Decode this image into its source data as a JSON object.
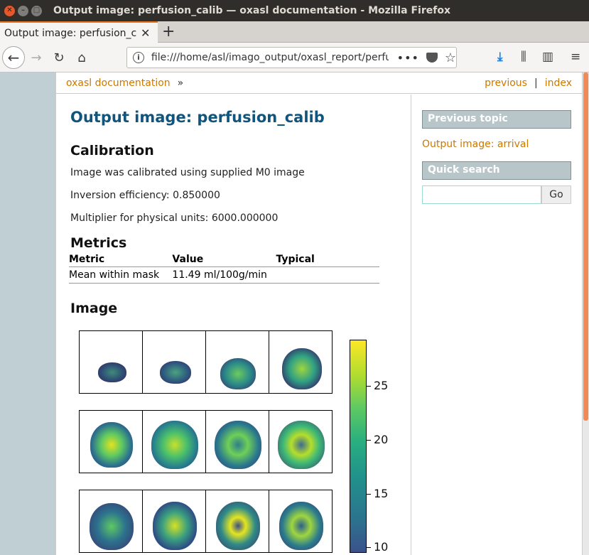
{
  "window": {
    "title": "Output image: perfusion_calib — oxasl documentation - Mozilla Firefox"
  },
  "tab": {
    "label": "Output image: perfusion_calib — oxasl documentation",
    "close": "✕",
    "new": "+"
  },
  "nav": {
    "url": "file:///home/asl/imago_output/oxasl_report/perfusion_calib.html",
    "dots": "•••"
  },
  "related": {
    "home": "oxasl documentation",
    "sep": "»",
    "previous": "previous",
    "pipe": "|",
    "index": "index"
  },
  "content": {
    "title": "Output image: perfusion_calib",
    "calibration": {
      "heading": "Calibration",
      "lines": [
        "Image was calibrated using supplied M0 image",
        "Inversion efficiency: 0.850000",
        "Multiplier for physical units: 6000.000000"
      ]
    },
    "metrics": {
      "heading": "Metrics",
      "columns": [
        "Metric",
        "Value",
        "Typical"
      ],
      "rows": [
        {
          "metric": "Mean within mask",
          "value": "11.49 ml/100g/min",
          "typical": ""
        }
      ]
    },
    "image": {
      "heading": "Image",
      "colorbar_ticks": [
        "25",
        "20",
        "15",
        "10"
      ]
    }
  },
  "sidebar": {
    "previous_heading": "Previous topic",
    "previous_link": "Output image: arrival",
    "search_heading": "Quick search",
    "search_button": "Go"
  }
}
